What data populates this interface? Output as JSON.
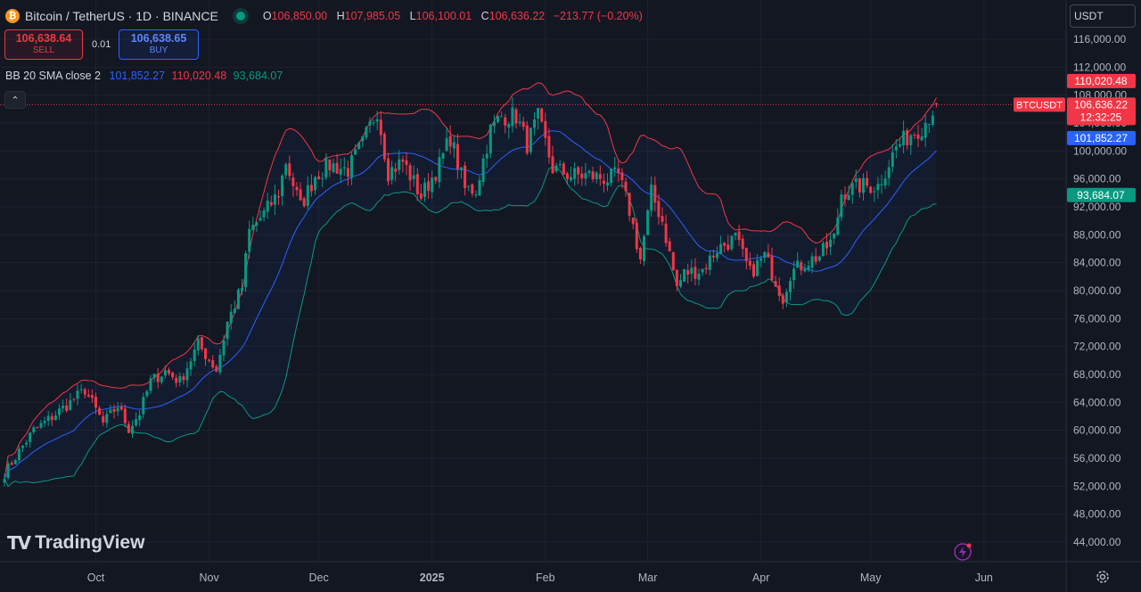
{
  "header": {
    "icon_glyph": "₿",
    "symbol": "Bitcoin / TetherUS · 1D · BINANCE",
    "open_label": "O",
    "open": "106,850.00",
    "high_label": "H",
    "high": "107,985.05",
    "low_label": "L",
    "low": "106,100.01",
    "close_label": "C",
    "close": "106,636.22",
    "change": "−213.77 (−0.20%)"
  },
  "trade": {
    "sell_price": "106,638.64",
    "sell_label": "SELL",
    "spread": "0.01",
    "buy_price": "106,638.65",
    "buy_label": "BUY"
  },
  "indicator": {
    "name": "BB 20 SMA close 2",
    "basis": "101,852.27",
    "upper": "110,020.48",
    "lower": "93,684.07",
    "collapse_glyph": "⌃"
  },
  "currency": "USDT",
  "brand": {
    "mark": "TV",
    "name": "TradingView"
  },
  "icons": {
    "live": "live-status-icon",
    "settings": "gear-icon",
    "alert": "lightning-icon"
  },
  "colors": {
    "background": "#131722",
    "up": "#089981",
    "down": "#f23645",
    "basis": "#2962ff",
    "upper": "#f23645",
    "lower": "#089981",
    "band_fill": "#2962ff"
  },
  "chart_data": {
    "type": "candlestick",
    "title": "Bitcoin / TetherUS · 1D · BINANCE",
    "y_ticks": [
      44000,
      48000,
      52000,
      56000,
      60000,
      64000,
      68000,
      72000,
      76000,
      80000,
      84000,
      88000,
      92000,
      96000,
      100000,
      104000,
      108000,
      112000,
      116000
    ],
    "y_tick_labels": [
      "44,000.00",
      "48,000.00",
      "52,000.00",
      "56,000.00",
      "60,000.00",
      "64,000.00",
      "68,000.00",
      "72,000.00",
      "76,000.00",
      "80,000.00",
      "84,000.00",
      "88,000.00",
      "92,000.00",
      "96,000.00",
      "100,000.00",
      "104,000.00",
      "108,000.00",
      "112,000.00",
      "116,000.00"
    ],
    "ylim": [
      42000,
      118000
    ],
    "x_ticks": [
      {
        "label": "Oct",
        "date": "2024-10-01"
      },
      {
        "label": "Nov",
        "date": "2024-11-01"
      },
      {
        "label": "Dec",
        "date": "2024-12-01"
      },
      {
        "label": "2025",
        "date": "2025-01-01",
        "bold": true
      },
      {
        "label": "Feb",
        "date": "2025-02-01"
      },
      {
        "label": "Mar",
        "date": "2025-03-01"
      },
      {
        "label": "Apr",
        "date": "2025-04-01"
      },
      {
        "label": "May",
        "date": "2025-05-01"
      },
      {
        "label": "Jun",
        "date": "2025-06-01"
      }
    ],
    "date_range": [
      "2024-09-06",
      "2025-05-19"
    ],
    "last_price": {
      "label": "BTCUSDT",
      "value": 106636.22,
      "text": "106,636.22",
      "countdown": "12:32:25"
    },
    "bb_labels": {
      "upper": {
        "value": 110020.48,
        "text": "110,020.48"
      },
      "basis": {
        "value": 101852.27,
        "text": "101,852.27"
      },
      "lower": {
        "value": 93684.07,
        "text": "93,684.07"
      }
    },
    "close_waypoints": [
      [
        "2024-09-06",
        53800
      ],
      [
        "2024-09-10",
        57000
      ],
      [
        "2024-09-14",
        60000
      ],
      [
        "2024-09-18",
        61500
      ],
      [
        "2024-09-24",
        64000
      ],
      [
        "2024-09-28",
        65800
      ],
      [
        "2024-10-03",
        61000
      ],
      [
        "2024-10-07",
        63500
      ],
      [
        "2024-10-10",
        60200
      ],
      [
        "2024-10-13",
        62500
      ],
      [
        "2024-10-16",
        67000
      ],
      [
        "2024-10-20",
        68500
      ],
      [
        "2024-10-24",
        67000
      ],
      [
        "2024-10-29",
        72300
      ],
      [
        "2024-11-03",
        68700
      ],
      [
        "2024-11-06",
        75500
      ],
      [
        "2024-11-10",
        80500
      ],
      [
        "2024-11-12",
        88500
      ],
      [
        "2024-11-16",
        91000
      ],
      [
        "2024-11-20",
        94000
      ],
      [
        "2024-11-22",
        98500
      ],
      [
        "2024-11-26",
        92000
      ],
      [
        "2024-11-30",
        96500
      ],
      [
        "2024-12-04",
        98000
      ],
      [
        "2024-12-09",
        97300
      ],
      [
        "2024-12-13",
        101000
      ],
      [
        "2024-12-17",
        106000
      ],
      [
        "2024-12-20",
        97000
      ],
      [
        "2024-12-24",
        98500
      ],
      [
        "2024-12-29",
        93500
      ],
      [
        "2025-01-03",
        98000
      ],
      [
        "2025-01-06",
        102000
      ],
      [
        "2025-01-10",
        94500
      ],
      [
        "2025-01-13",
        94500
      ],
      [
        "2025-01-17",
        103000
      ],
      [
        "2025-01-20",
        105000
      ],
      [
        "2025-01-24",
        105000
      ],
      [
        "2025-01-27",
        101000
      ],
      [
        "2025-01-30",
        104700
      ],
      [
        "2025-02-03",
        97500
      ],
      [
        "2025-02-08",
        96500
      ],
      [
        "2025-02-13",
        96500
      ],
      [
        "2025-02-18",
        96000
      ],
      [
        "2025-02-21",
        96500
      ],
      [
        "2025-02-24",
        91500
      ],
      [
        "2025-02-27",
        84500
      ],
      [
        "2025-03-02",
        94000
      ],
      [
        "2025-03-05",
        90000
      ],
      [
        "2025-03-09",
        80500
      ],
      [
        "2025-03-11",
        82500
      ],
      [
        "2025-03-16",
        83000
      ],
      [
        "2025-03-20",
        86000
      ],
      [
        "2025-03-25",
        87500
      ],
      [
        "2025-03-29",
        82500
      ],
      [
        "2025-04-02",
        85000
      ],
      [
        "2025-04-07",
        79000
      ],
      [
        "2025-04-09",
        82500
      ],
      [
        "2025-04-13",
        84000
      ],
      [
        "2025-04-17",
        85000
      ],
      [
        "2025-04-21",
        87500
      ],
      [
        "2025-04-23",
        94000
      ],
      [
        "2025-04-28",
        95000
      ],
      [
        "2025-05-03",
        95000
      ],
      [
        "2025-05-08",
        100500
      ],
      [
        "2025-05-12",
        102500
      ],
      [
        "2025-05-15",
        103500
      ],
      [
        "2025-05-19",
        106636
      ]
    ]
  }
}
